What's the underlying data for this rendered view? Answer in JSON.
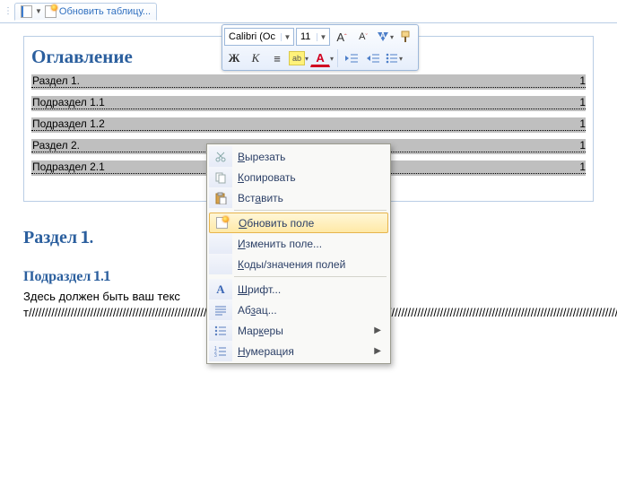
{
  "tab": {
    "label": "Обновить таблицу..."
  },
  "toc": {
    "title": "Оглавление",
    "rows": [
      {
        "label": "Раздел 1.",
        "page": "1"
      },
      {
        "label": "Подраздел 1.1",
        "page": "1"
      },
      {
        "label": "Подраздел 1.2",
        "page": "1"
      },
      {
        "label": "Раздел 2.",
        "page": "1"
      },
      {
        "label": "Подраздел 2.1",
        "page": "1"
      }
    ]
  },
  "minibar": {
    "font": "Calibri (Ос",
    "size": "11",
    "grow": "A",
    "shrink": "A",
    "bold": "Ж",
    "italic": "К",
    "align": "≡",
    "fontcolor": "A"
  },
  "context": {
    "cut": "Вырезать",
    "copy": "Копировать",
    "paste": "Вставить",
    "update": "Обновить поле",
    "edit": "Изменить поле...",
    "codes": "Коды/значения полей",
    "font": "Шрифт...",
    "para": "Абзац...",
    "bullets": "Маркеры",
    "numbering": "Нумерация"
  },
  "doc": {
    "h1": "Раздел 1.",
    "h2": "Подраздел 1.1",
    "text": "Здесь должен быть ваш текст//////////////////////////////////////////////////////////////////////////////////////////////////////////////////////////////////////////////////////////////////////////////////////////////////////////////////////////////////////////////////"
  }
}
